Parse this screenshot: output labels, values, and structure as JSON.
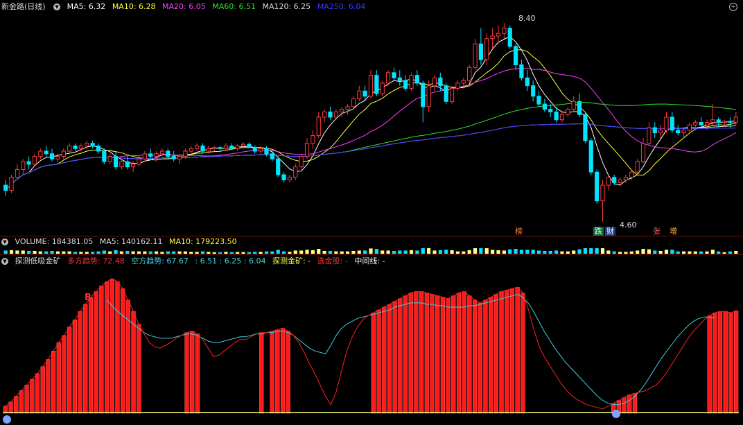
{
  "main_legend": {
    "stock_name": "新金路(日线)",
    "ma5": "MA5: 6.32",
    "ma10": "MA10: 6.28",
    "ma20": "MA20: 6.05",
    "ma60": "MA60: 6.51",
    "ma120": "MA120: 6.25",
    "ma250": "MA250: 6.04"
  },
  "price_labels": {
    "high": "8.40",
    "low": "4.60"
  },
  "event_tags": [
    "榜",
    "跌",
    "财",
    "张",
    "增"
  ],
  "volume_legend": {
    "volume": "VOLUME: 184381.05",
    "ma5": "MA5: 140162.11",
    "ma10": "MA10: 179223.50"
  },
  "indicator_legend": {
    "name": "探测低吸金矿",
    "long_trend": "多方趋势: 72.48",
    "short_trend": "空方趋势: 67.67",
    "vals": ": 6.51  : 6.25  : 6.04",
    "gold_mine": "探测金矿: -",
    "select": "选金股: -",
    "midline": "中间线: -"
  },
  "buy_marker": "B",
  "colors": {
    "up": "#ff3c3c",
    "down": "#00e5ff",
    "ma5": "#ffffff",
    "ma10": "#ffff3c",
    "ma20": "#ff40ff",
    "ma60": "#30e030",
    "ma120": "#dddddd",
    "ma250": "#3a3aff",
    "long_line": "#ff2020",
    "short_line": "#40d0e0"
  },
  "chart_data": [
    {
      "type": "candlestick",
      "title": "新金路(日线)",
      "ylim": [
        4.4,
        8.6
      ],
      "candles": [
        [
          5.3,
          5.4,
          5.1,
          5.2
        ],
        [
          5.2,
          5.5,
          5.15,
          5.45
        ],
        [
          5.45,
          5.7,
          5.4,
          5.6
        ],
        [
          5.6,
          5.8,
          5.5,
          5.75
        ],
        [
          5.75,
          5.85,
          5.6,
          5.7
        ],
        [
          5.7,
          5.9,
          5.65,
          5.85
        ],
        [
          5.85,
          6.0,
          5.8,
          5.95
        ],
        [
          5.95,
          6.05,
          5.85,
          5.9
        ],
        [
          5.9,
          6.0,
          5.75,
          5.8
        ],
        [
          5.8,
          5.9,
          5.7,
          5.85
        ],
        [
          5.85,
          6.0,
          5.8,
          5.95
        ],
        [
          5.95,
          6.1,
          5.9,
          6.05
        ],
        [
          6.05,
          6.1,
          5.95,
          6.0
        ],
        [
          6.0,
          6.1,
          5.95,
          6.05
        ],
        [
          6.05,
          6.15,
          6.0,
          6.1
        ],
        [
          6.1,
          6.15,
          6.0,
          6.05
        ],
        [
          6.05,
          6.1,
          5.9,
          5.95
        ],
        [
          5.95,
          6.0,
          5.7,
          5.75
        ],
        [
          5.75,
          5.9,
          5.7,
          5.85
        ],
        [
          5.85,
          5.95,
          5.6,
          5.65
        ],
        [
          5.65,
          5.8,
          5.6,
          5.75
        ],
        [
          5.75,
          5.85,
          5.6,
          5.65
        ],
        [
          5.65,
          5.75,
          5.55,
          5.7
        ],
        [
          5.7,
          5.85,
          5.65,
          5.8
        ],
        [
          5.8,
          5.95,
          5.75,
          5.9
        ],
        [
          5.9,
          6.0,
          5.8,
          5.85
        ],
        [
          5.85,
          5.95,
          5.75,
          5.9
        ],
        [
          5.9,
          6.0,
          5.85,
          5.95
        ],
        [
          5.95,
          6.0,
          5.8,
          5.85
        ],
        [
          5.85,
          5.95,
          5.75,
          5.8
        ],
        [
          5.8,
          5.9,
          5.7,
          5.85
        ],
        [
          5.85,
          6.0,
          5.8,
          5.95
        ],
        [
          5.95,
          6.05,
          5.9,
          6.0
        ],
        [
          6.0,
          6.1,
          5.95,
          6.05
        ],
        [
          6.05,
          6.1,
          5.9,
          5.95
        ],
        [
          5.95,
          6.05,
          5.9,
          6.0
        ],
        [
          6.0,
          6.05,
          5.95,
          6.02
        ],
        [
          6.02,
          6.05,
          5.95,
          6.0
        ],
        [
          6.0,
          6.1,
          5.95,
          6.05
        ],
        [
          6.05,
          6.1,
          5.98,
          6.0
        ],
        [
          6.0,
          6.08,
          5.95,
          6.05
        ],
        [
          6.05,
          6.12,
          6.0,
          6.08
        ],
        [
          6.08,
          6.12,
          6.0,
          6.02
        ],
        [
          6.02,
          6.06,
          5.9,
          5.95
        ],
        [
          5.95,
          6.05,
          5.9,
          6.0
        ],
        [
          6.0,
          6.05,
          5.85,
          5.9
        ],
        [
          5.9,
          5.95,
          5.75,
          5.8
        ],
        [
          5.8,
          5.85,
          5.45,
          5.5
        ],
        [
          5.5,
          5.55,
          5.35,
          5.4
        ],
        [
          5.4,
          5.5,
          5.35,
          5.45
        ],
        [
          5.45,
          5.7,
          5.4,
          5.65
        ],
        [
          5.65,
          5.9,
          5.6,
          5.85
        ],
        [
          5.85,
          6.2,
          5.8,
          6.1
        ],
        [
          6.1,
          6.35,
          6.0,
          6.25
        ],
        [
          6.25,
          6.7,
          6.2,
          6.6
        ],
        [
          6.6,
          6.75,
          6.5,
          6.7
        ],
        [
          6.7,
          6.8,
          6.55,
          6.6
        ],
        [
          6.6,
          6.75,
          6.55,
          6.7
        ],
        [
          6.7,
          6.8,
          6.6,
          6.75
        ],
        [
          6.75,
          6.85,
          6.65,
          6.8
        ],
        [
          6.8,
          7.0,
          6.75,
          6.95
        ],
        [
          6.95,
          7.2,
          6.9,
          7.1
        ],
        [
          7.1,
          7.2,
          6.9,
          7.0
        ],
        [
          7.0,
          7.5,
          6.95,
          7.4
        ],
        [
          7.4,
          7.5,
          7.0,
          7.05
        ],
        [
          7.05,
          7.3,
          7.0,
          7.25
        ],
        [
          7.25,
          7.5,
          7.2,
          7.45
        ],
        [
          7.45,
          7.55,
          7.3,
          7.35
        ],
        [
          7.35,
          7.5,
          7.2,
          7.3
        ],
        [
          7.3,
          7.4,
          7.1,
          7.15
        ],
        [
          7.15,
          7.45,
          7.1,
          7.4
        ],
        [
          7.4,
          7.5,
          7.2,
          7.25
        ],
        [
          7.25,
          7.3,
          6.5,
          6.8
        ],
        [
          6.8,
          7.3,
          6.7,
          7.2
        ],
        [
          7.2,
          7.4,
          7.1,
          7.35
        ],
        [
          7.35,
          7.45,
          7.1,
          7.2
        ],
        [
          7.2,
          7.25,
          6.85,
          6.9
        ],
        [
          6.9,
          7.2,
          6.85,
          7.15
        ],
        [
          7.15,
          7.3,
          7.1,
          7.25
        ],
        [
          7.25,
          7.35,
          7.15,
          7.3
        ],
        [
          7.3,
          7.6,
          7.25,
          7.55
        ],
        [
          7.55,
          8.1,
          7.5,
          8.0
        ],
        [
          8.0,
          8.3,
          7.6,
          7.7
        ],
        [
          7.7,
          8.2,
          7.6,
          8.1
        ],
        [
          8.1,
          8.3,
          7.9,
          8.15
        ],
        [
          8.15,
          8.35,
          8.0,
          8.2
        ],
        [
          8.2,
          8.4,
          8.1,
          8.3
        ],
        [
          8.3,
          8.35,
          7.9,
          7.95
        ],
        [
          7.95,
          8.0,
          7.5,
          7.6
        ],
        [
          7.6,
          7.7,
          7.3,
          7.35
        ],
        [
          7.35,
          7.5,
          7.1,
          7.2
        ],
        [
          7.2,
          7.3,
          6.9,
          7.0
        ],
        [
          7.0,
          7.1,
          6.8,
          6.85
        ],
        [
          6.85,
          6.95,
          6.7,
          6.75
        ],
        [
          6.75,
          6.85,
          6.6,
          6.7
        ],
        [
          6.7,
          6.8,
          6.5,
          6.55
        ],
        [
          6.55,
          6.7,
          6.5,
          6.65
        ],
        [
          6.65,
          6.8,
          6.6,
          6.75
        ],
        [
          6.75,
          7.0,
          6.7,
          6.9
        ],
        [
          6.9,
          7.05,
          6.6,
          6.65
        ],
        [
          6.65,
          6.7,
          6.1,
          6.15
        ],
        [
          6.15,
          6.2,
          5.5,
          5.55
        ],
        [
          5.55,
          5.6,
          4.95,
          5.0
        ],
        [
          5.0,
          5.4,
          4.6,
          5.3
        ],
        [
          5.3,
          5.5,
          5.2,
          5.45
        ],
        [
          5.45,
          5.5,
          5.3,
          5.35
        ],
        [
          5.35,
          5.45,
          5.3,
          5.4
        ],
        [
          5.4,
          5.5,
          5.35,
          5.45
        ],
        [
          5.45,
          5.6,
          5.4,
          5.55
        ],
        [
          5.55,
          5.8,
          5.5,
          5.75
        ],
        [
          5.75,
          6.2,
          5.7,
          6.1
        ],
        [
          6.1,
          6.5,
          6.05,
          6.4
        ],
        [
          6.4,
          6.5,
          6.2,
          6.3
        ],
        [
          6.3,
          6.45,
          6.2,
          6.35
        ],
        [
          6.35,
          6.7,
          6.3,
          6.6
        ],
        [
          6.6,
          6.7,
          6.3,
          6.35
        ],
        [
          6.35,
          6.45,
          6.25,
          6.3
        ],
        [
          6.3,
          6.4,
          6.2,
          6.35
        ],
        [
          6.35,
          6.5,
          6.3,
          6.45
        ],
        [
          6.45,
          6.55,
          6.35,
          6.5
        ],
        [
          6.5,
          6.6,
          6.4,
          6.45
        ],
        [
          6.45,
          6.55,
          6.35,
          6.5
        ],
        [
          6.5,
          6.85,
          6.45,
          6.55
        ],
        [
          6.55,
          6.6,
          6.4,
          6.5
        ],
        [
          6.5,
          6.55,
          6.45,
          6.52
        ],
        [
          6.52,
          6.6,
          6.4,
          6.5
        ],
        [
          6.5,
          6.7,
          6.45,
          6.6
        ]
      ]
    },
    {
      "type": "line",
      "title": "探测低吸金矿",
      "ylim": [
        0,
        100
      ],
      "long_trend": [
        5,
        8,
        12,
        16,
        20,
        24,
        28,
        33,
        38,
        44,
        50,
        55,
        61,
        66,
        72,
        77,
        82,
        86,
        90,
        93,
        95,
        93,
        88,
        80,
        72,
        63,
        56,
        50,
        47,
        46,
        48,
        50,
        53,
        55,
        57,
        58,
        56,
        52,
        46,
        40,
        41,
        44,
        47,
        50,
        52,
        52,
        54,
        56,
        57,
        57,
        58,
        59,
        60,
        58,
        55,
        50,
        43,
        35,
        28,
        20,
        12,
        6,
        15,
        30,
        44,
        54,
        61,
        66,
        69,
        71,
        73,
        75,
        77,
        79,
        81,
        83,
        85,
        86,
        86,
        85,
        84,
        83,
        82,
        81,
        83,
        85,
        86,
        83,
        80,
        78,
        80,
        82,
        84,
        86,
        87,
        88,
        89,
        85,
        74,
        60,
        48,
        40,
        34,
        28,
        22,
        17,
        13,
        10,
        8,
        6,
        5,
        4,
        3,
        5,
        7,
        9,
        11,
        13,
        14,
        15,
        16,
        18,
        20,
        24,
        29,
        35,
        41,
        47,
        53,
        58,
        62,
        66,
        69,
        71,
        72,
        72,
        71,
        72.48
      ],
      "short_trend": [
        null,
        null,
        null,
        null,
        null,
        null,
        null,
        null,
        null,
        null,
        null,
        null,
        null,
        null,
        null,
        null,
        null,
        null,
        null,
        80,
        76,
        72,
        69,
        66,
        63,
        60,
        57,
        55,
        54,
        53,
        53,
        53,
        54,
        55,
        56,
        56,
        55,
        53,
        51,
        50,
        50,
        51,
        52,
        53,
        54,
        54,
        55,
        56,
        56,
        57,
        57,
        58,
        58,
        57,
        55,
        52,
        49,
        46,
        44,
        43,
        42,
        48,
        55,
        60,
        63,
        65,
        67,
        68,
        69,
        70,
        71,
        72,
        73,
        75,
        76,
        77,
        78,
        78,
        78,
        77,
        77,
        76,
        76,
        75,
        75,
        75,
        75,
        76,
        76,
        77,
        78,
        79,
        80,
        81,
        82,
        83,
        84,
        82,
        78,
        72,
        65,
        58,
        52,
        46,
        41,
        36,
        32,
        28,
        24,
        20,
        16,
        12,
        9,
        7,
        6,
        6,
        7,
        9,
        12,
        16,
        21,
        27,
        33,
        39,
        44,
        49,
        54,
        58,
        62,
        65,
        67,
        68,
        68,
        67.67
      ],
      "histogram_bars": "long_trend where long_trend > short_trend",
      "buy_marker_index": 20
    }
  ]
}
